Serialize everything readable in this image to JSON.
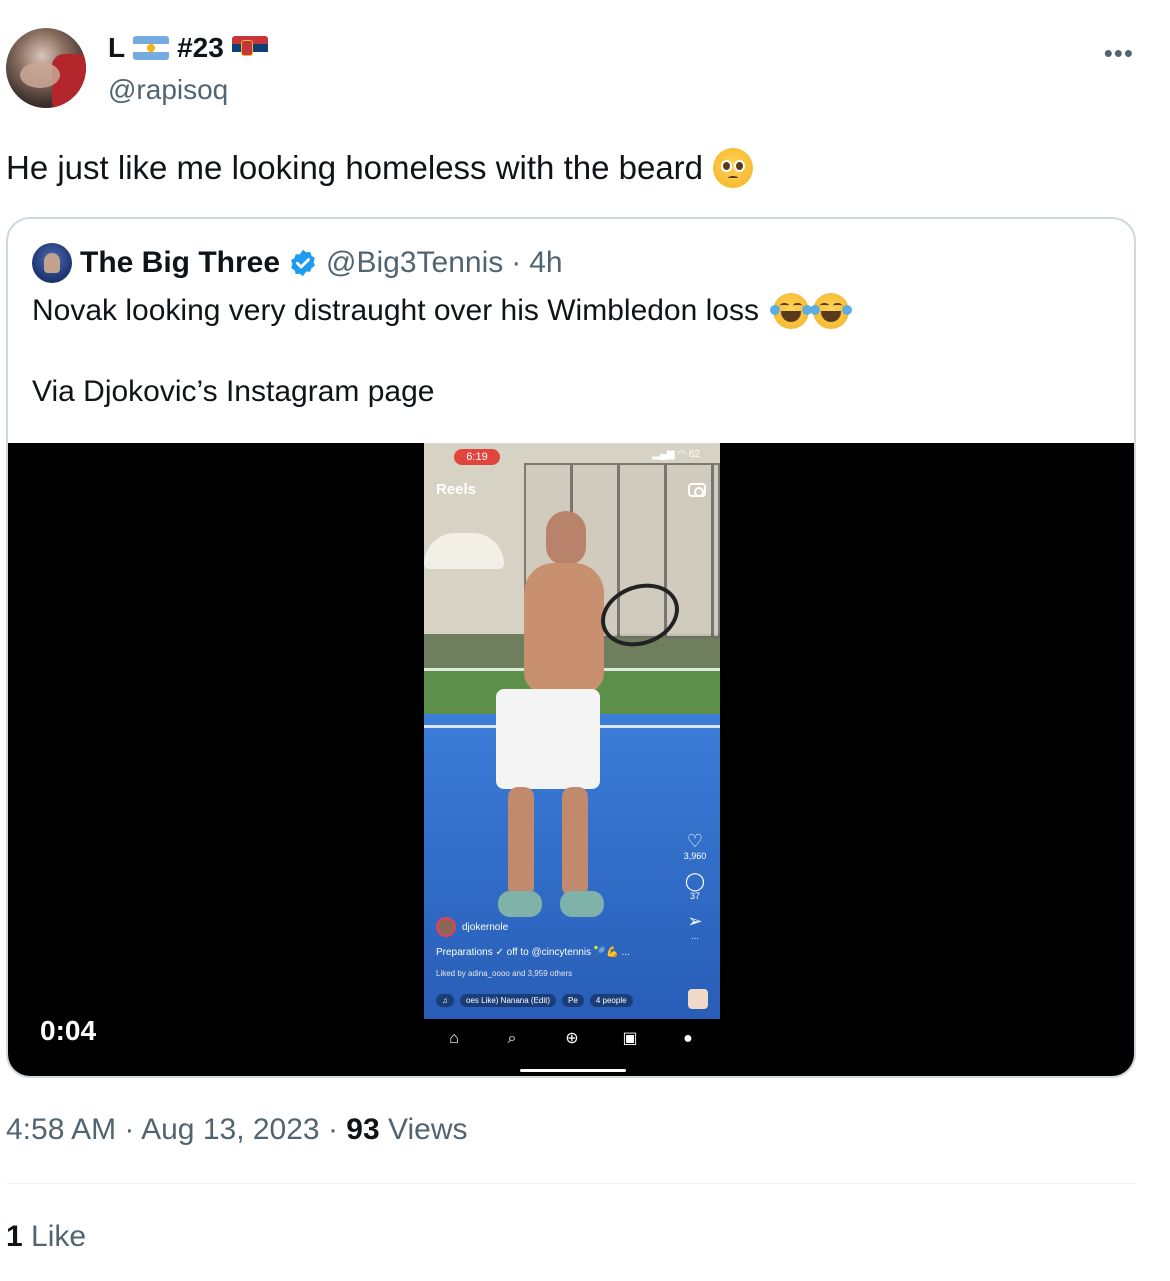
{
  "author": {
    "name_prefix": "L",
    "name_number": "#23",
    "handle": "@rapisoq",
    "flag_left": "argentina-flag",
    "flag_right": "serbia-flag"
  },
  "tweet": {
    "text": "He just like me looking homeless with the beard",
    "emoji": "pleading-face"
  },
  "quoted": {
    "name": "The Big Three",
    "handle": "@Big3Tennis",
    "separator": "·",
    "age": "4h",
    "line1": "Novak looking very distraught over his Wimbledon loss",
    "line2": "Via Djokovic’s Instagram page",
    "verified_color": "#1d9bf0"
  },
  "video": {
    "duration": "0:04",
    "phone": {
      "status_time": "6:19",
      "battery": "62",
      "reels_title": "Reels",
      "likes": "3,960",
      "comments": "37",
      "more": "...",
      "username": "djokernole",
      "caption": "Preparations ✓ off to @cincytennis 🎾💪 ...",
      "liked_by": "Liked by adina_oooo and 3,959 others",
      "audio": "oes Like) Nanana (Edit)",
      "audio_extra": "Pe",
      "people": "4 people"
    }
  },
  "meta": {
    "time": "4:58 AM",
    "dot": "·",
    "date": "Aug 13, 2023",
    "views_count": "93",
    "views_label": "Views"
  },
  "engagement": {
    "likes_count": "1",
    "likes_label": "Like"
  }
}
